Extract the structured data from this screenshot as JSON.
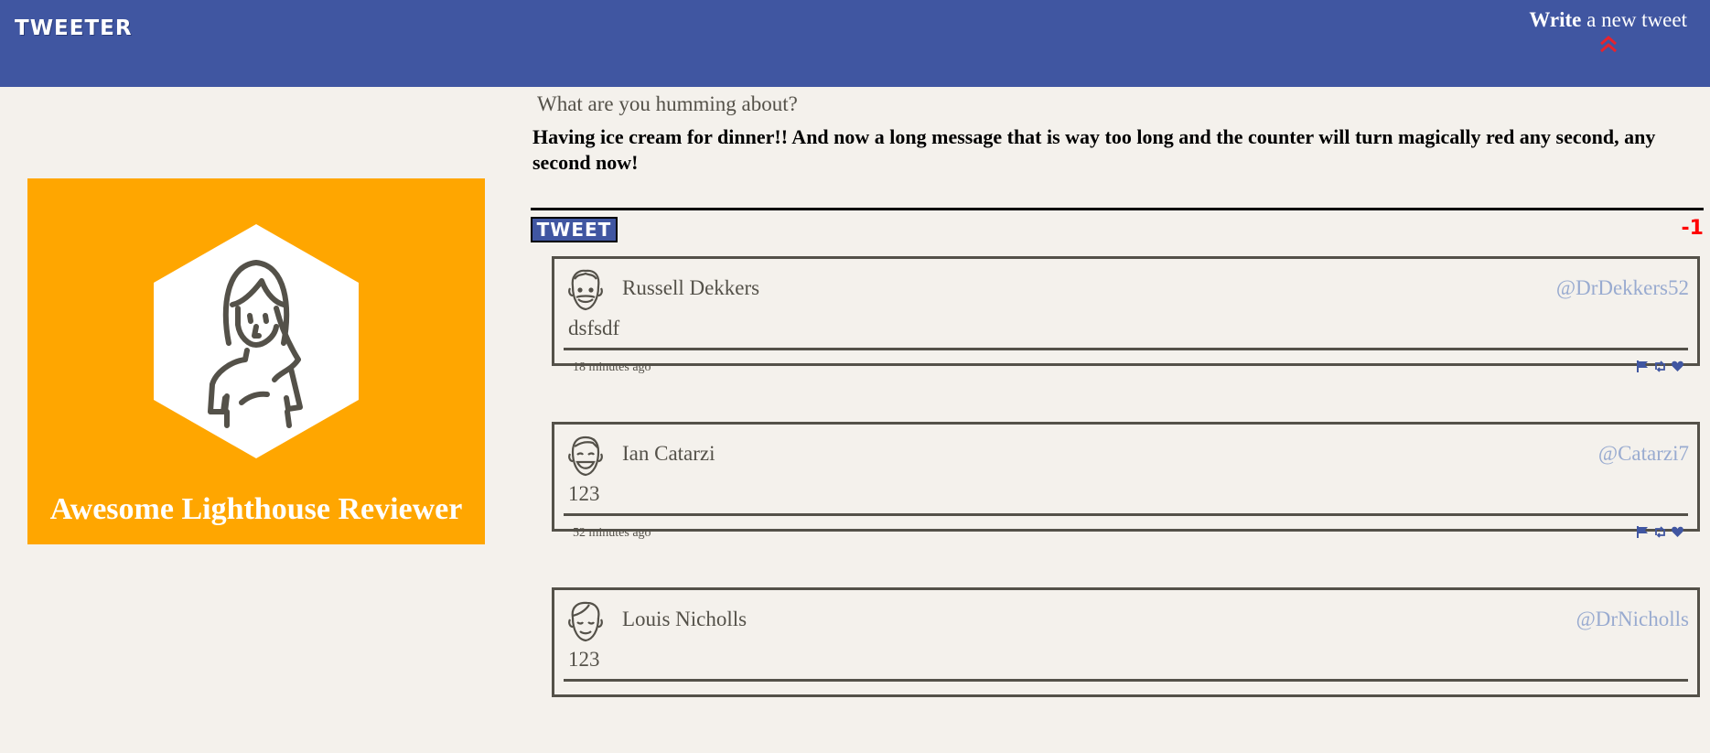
{
  "nav": {
    "brand": "TWEETER",
    "write_bold": "Write",
    "write_rest": " a new tweet",
    "chevron_icon": "double-chevron-up-icon",
    "chevron_color": "#e8222d"
  },
  "profile": {
    "name": "Awesome Lighthouse Reviewer",
    "bg_color": "#ffa600"
  },
  "compose": {
    "label": "What are you humming about?",
    "text": "Having ice cream for dinner!! And now a long message that is way too long and the counter will turn magically red any second, any second now!",
    "button": "TWEET",
    "counter": "-1",
    "counter_color": "#ff0000"
  },
  "tweets": [
    {
      "name": "Russell Dekkers",
      "handle": "@DrDekkers52",
      "content": "dsfsdf",
      "time": "18 minutes ago"
    },
    {
      "name": "Ian Catarzi",
      "handle": "@Catarzi7",
      "content": "123",
      "time": "52 minutes ago"
    },
    {
      "name": "Louis Nicholls",
      "handle": "@DrNicholls",
      "content": "123",
      "time": ""
    }
  ],
  "colors": {
    "nav": "#4056a1",
    "background": "#f4f1ec",
    "handle": "#99abd0"
  }
}
